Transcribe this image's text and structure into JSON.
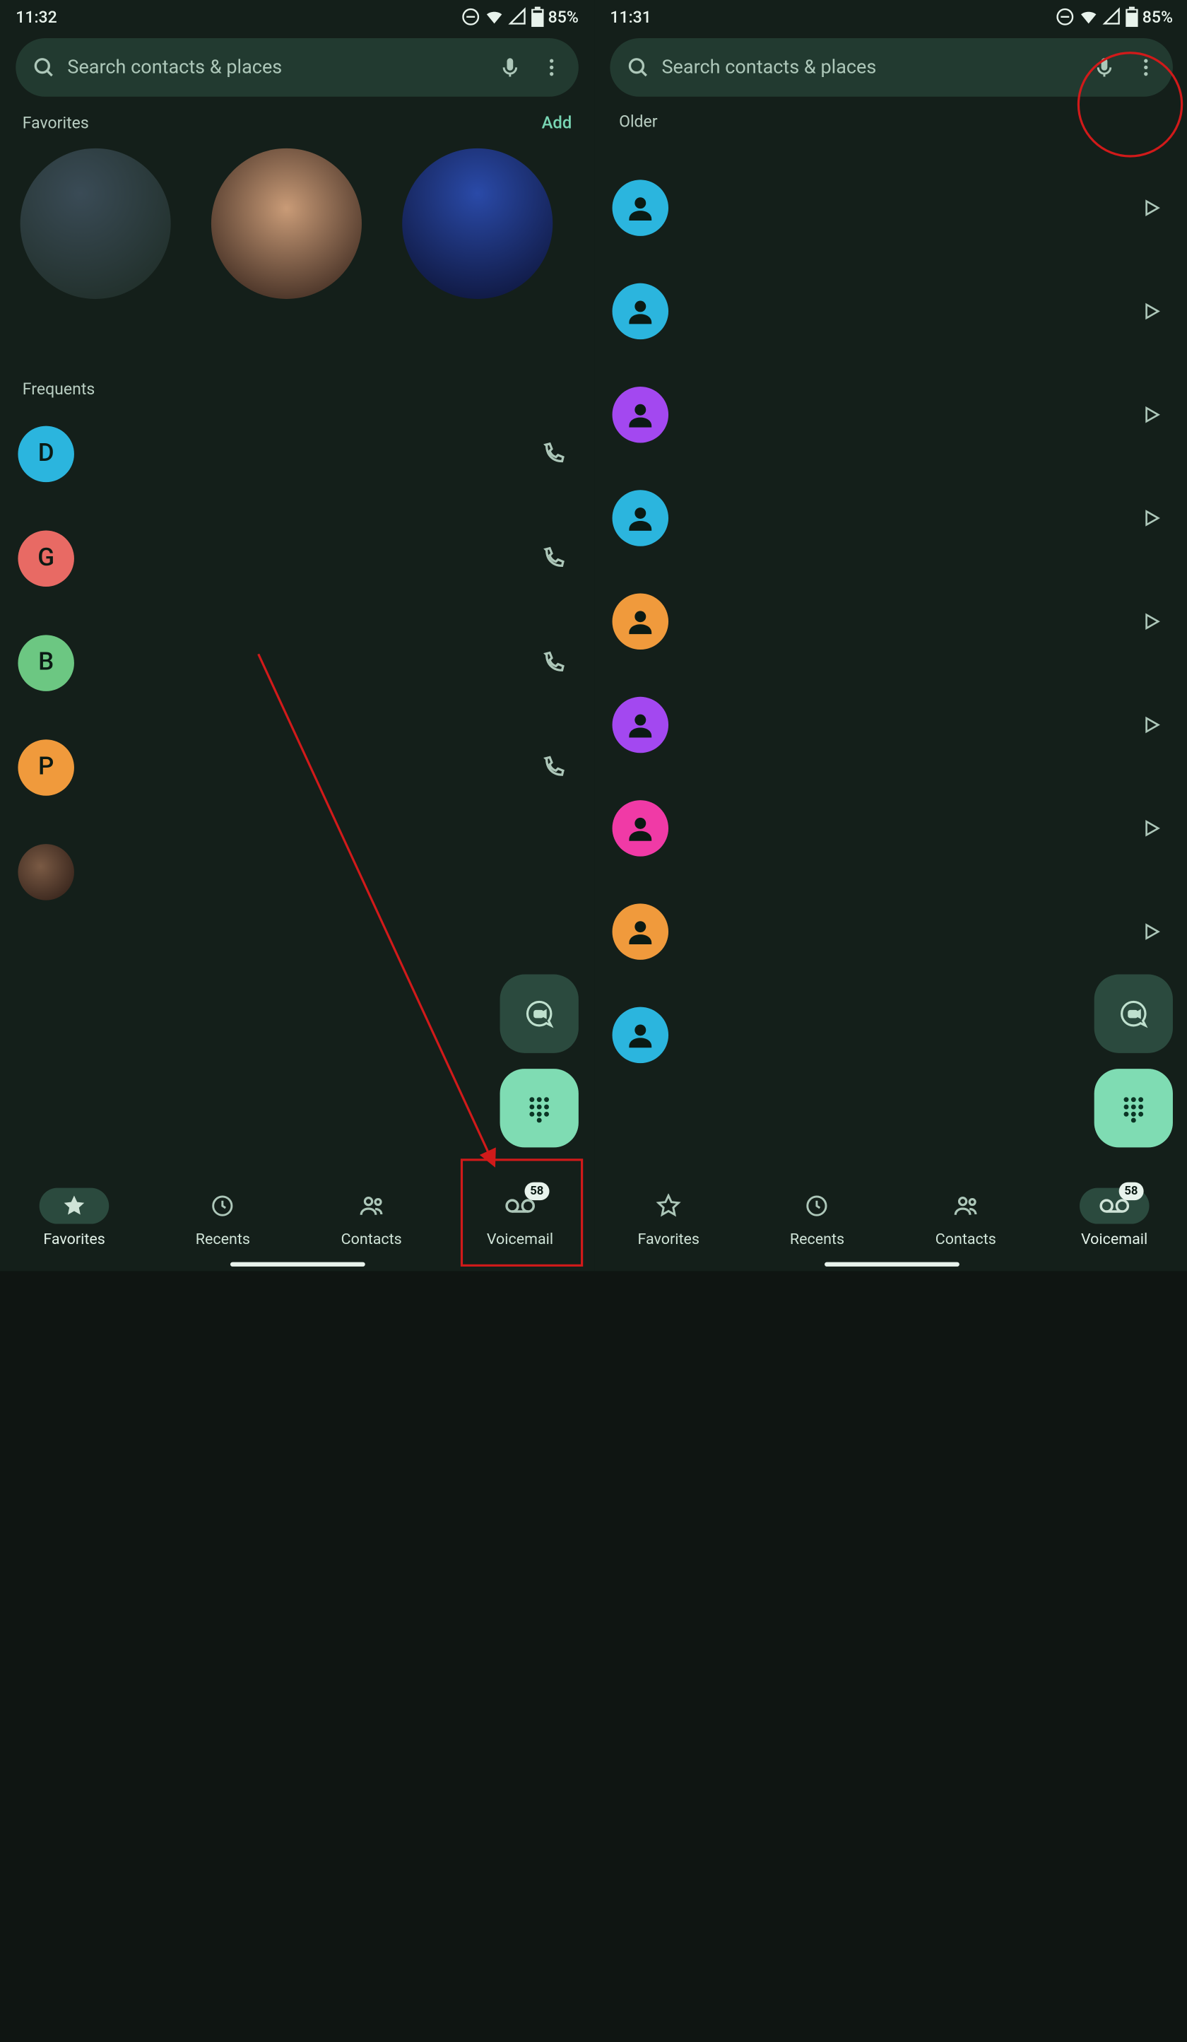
{
  "status": {
    "time_left": "11:32",
    "time_right": "11:31",
    "battery": "85%"
  },
  "search": {
    "placeholder": "Search contacts & places"
  },
  "favorites": {
    "label": "Favorites",
    "add": "Add"
  },
  "frequents": {
    "label": "Frequents",
    "items": [
      {
        "letter": "D",
        "color": "#2bb5de"
      },
      {
        "letter": "G",
        "color": "#e86a64"
      },
      {
        "letter": "B",
        "color": "#6cc782"
      },
      {
        "letter": "P",
        "color": "#f09a3c"
      },
      {
        "letter": "",
        "color": "#5a3f35"
      }
    ]
  },
  "voicemail": {
    "label": "Older",
    "items": [
      {
        "color": "#2bb5de"
      },
      {
        "color": "#2bb5de"
      },
      {
        "color": "#a348f0"
      },
      {
        "color": "#2bb5de"
      },
      {
        "color": "#f09a3c"
      },
      {
        "color": "#a348f0"
      },
      {
        "color": "#f03aa6"
      },
      {
        "color": "#f09a3c"
      },
      {
        "color": "#2bb5de"
      }
    ]
  },
  "nav": {
    "favorites": "Favorites",
    "recents": "Recents",
    "contacts": "Contacts",
    "voicemail": "Voicemail",
    "vm_badge": "58"
  },
  "fav_bg": [
    "radial-gradient(circle at 40% 30%, #3a4b56, #1c2a22)",
    "radial-gradient(circle at 50% 40%, #c99b77, #2a1a14)",
    "radial-gradient(circle at 50% 30%, #2a4aa8, #0b1030)"
  ]
}
